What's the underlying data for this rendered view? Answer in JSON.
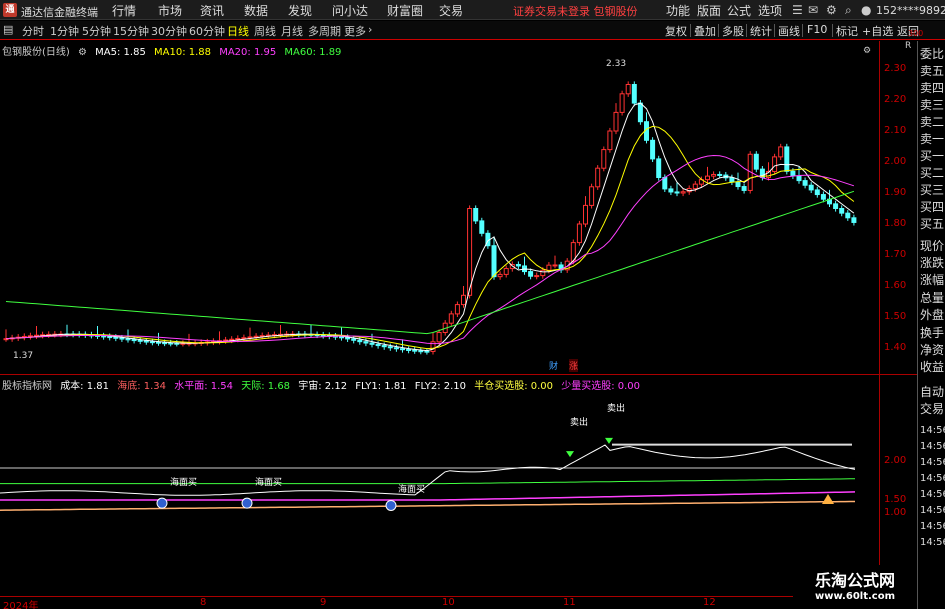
{
  "app": {
    "logo": "通",
    "title": "通达信金融终端"
  },
  "menu": [
    "行情",
    "市场",
    "资讯",
    "数据",
    "发现",
    "问小达",
    "财富圈",
    "交易"
  ],
  "warning": "证券交易未登录  包钢股份",
  "right_menu": [
    "功能",
    "版面",
    "公式",
    "选项"
  ],
  "user": "152****9892",
  "toolbar": {
    "timeframes": [
      "分时",
      "1分钟",
      "5分钟",
      "15分钟",
      "30分钟",
      "60分钟",
      "日线",
      "周线",
      "月线",
      "多周期",
      "更多"
    ],
    "active": "日线",
    "right": [
      "复权",
      "叠加",
      "多股",
      "统计",
      "画线",
      "F10",
      "+自选",
      "返回"
    ]
  },
  "sidebar": [
    "委比",
    "卖五",
    "卖四",
    "卖三",
    "卖二",
    "卖一",
    "买一",
    "买二",
    "买三",
    "买四",
    "买五",
    "现价",
    "涨跌",
    "涨幅",
    "总量",
    "外盘",
    "换手",
    "净资",
    "收益",
    "自动",
    "交易"
  ],
  "main_legend": {
    "name": "包钢股份(日线)",
    "ma5": "MA5: 1.85",
    "ma10": "MA10: 1.88",
    "ma20": "MA20: 1.95",
    "ma60": "MA60: 1.89"
  },
  "sub_legend": {
    "name": "股标指标网",
    "items": [
      {
        "text": "成本: 1.81",
        "color": "#ffffff"
      },
      {
        "text": "海底: 1.34",
        "color": "#ff6060"
      },
      {
        "text": "水平面: 1.54",
        "color": "#ff40ff"
      },
      {
        "text": "天际: 1.68",
        "color": "#40ff40"
      },
      {
        "text": "宇宙: 2.12",
        "color": "#ffffff"
      },
      {
        "text": "FLY1: 1.81",
        "color": "#ffffff"
      },
      {
        "text": "FLY2: 2.10",
        "color": "#ffffff"
      },
      {
        "text": "半仓买选股: 0.00",
        "color": "#ffff40"
      },
      {
        "text": "少量买选股: 0.00",
        "color": "#ff40ff"
      }
    ]
  },
  "price_axis": [
    "2.30",
    "2.20",
    "2.10",
    "2.00",
    "1.90",
    "1.80",
    "1.70",
    "1.60",
    "1.50",
    "1.40"
  ],
  "sub_axis": [
    "2.00",
    "1.50",
    "1.00"
  ],
  "sub_right": [
    "14:56",
    "14:56",
    "14:56",
    "14:56",
    "14:56",
    "14:56",
    "14:56",
    "14:56"
  ],
  "annotations": {
    "high": "2.33",
    "low": "1.37",
    "cai": "财",
    "zhang": "涨",
    "sell1": "卖出",
    "sell2": "卖出",
    "buy1": "海面买",
    "buy2": "海面买",
    "buy3": "海面买",
    "corner": "R",
    "corner_num": "300"
  },
  "x_axis": [
    "2024年",
    "8",
    "9",
    "10",
    "11",
    "12"
  ],
  "watermark": {
    "line1": "乐淘公式网",
    "line2": "www.60lt.com"
  }
}
